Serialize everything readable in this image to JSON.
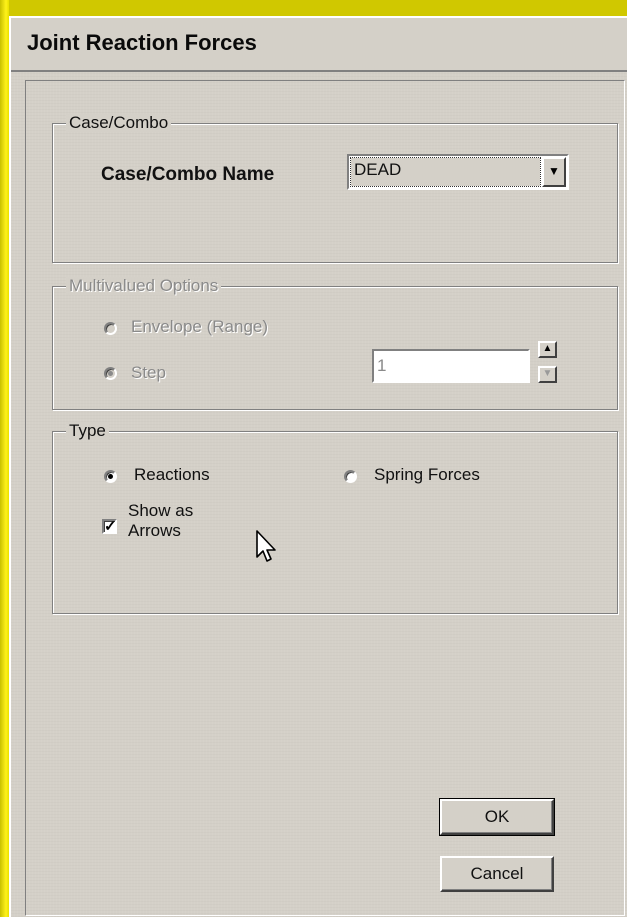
{
  "window": {
    "title": "Joint Reaction Forces"
  },
  "case_combo_group": {
    "legend": "Case/Combo",
    "name_label": "Case/Combo Name",
    "selected_value": "DEAD",
    "dropdown_icon": "chevron-down-icon"
  },
  "multivalued_group": {
    "legend": "Multivalued Options",
    "envelope_label": "Envelope (Range)",
    "step_label": "Step",
    "step_value": "1",
    "enabled": false,
    "selected": "Step"
  },
  "type_group": {
    "legend": "Type",
    "reactions_label": "Reactions",
    "spring_forces_label": "Spring Forces",
    "selected": "Reactions",
    "show_as_arrows_line1": "Show as",
    "show_as_arrows_line2": "Arrows",
    "show_as_arrows_checked": true
  },
  "buttons": {
    "ok_label": "OK",
    "cancel_label": "Cancel"
  },
  "colors": {
    "dialog_face": "#d4d0c8",
    "desktop_yellow": "#d4cc00",
    "disabled_text": "#8a8a8a"
  }
}
